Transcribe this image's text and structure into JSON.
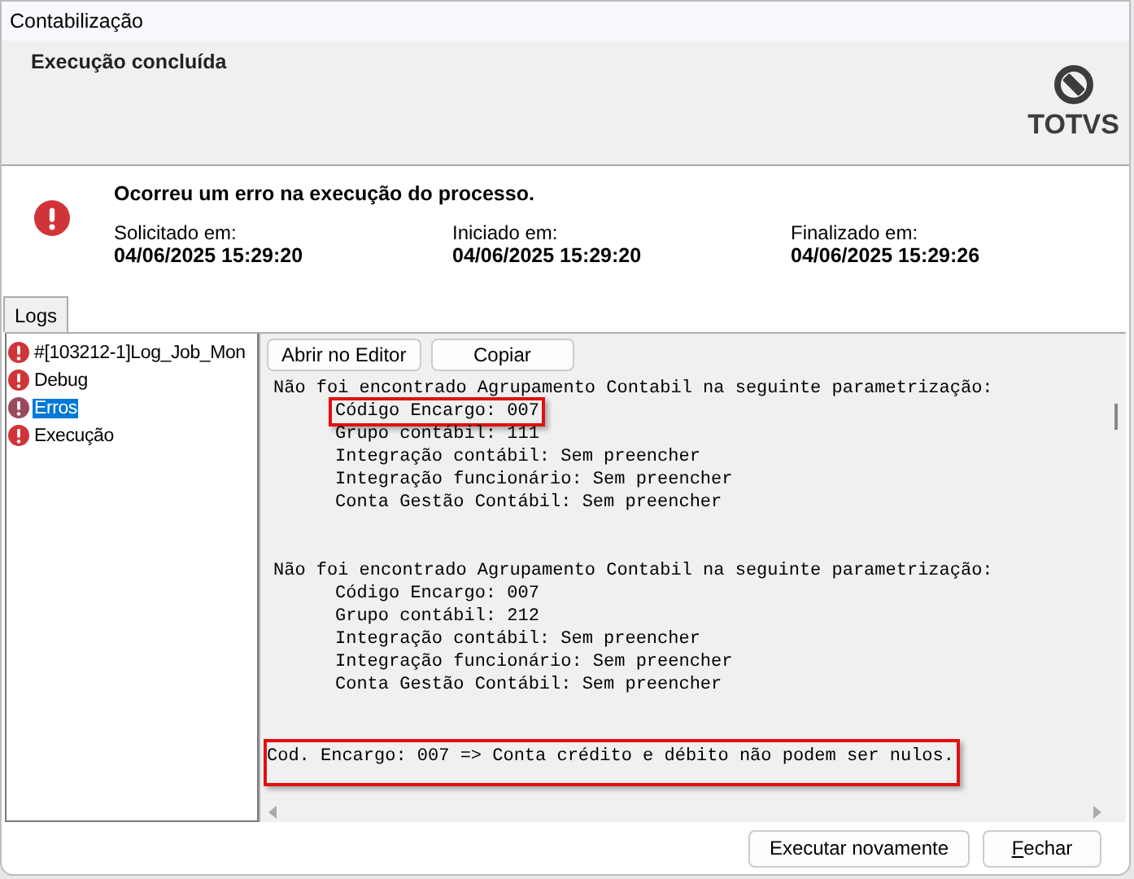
{
  "window": {
    "title": "Contabilização"
  },
  "header": {
    "title": "Execução concluída",
    "logo": "TOTVS"
  },
  "summary": {
    "message": "Ocorreu um erro na execução do processo.",
    "times": [
      {
        "label": "Solicitado em:",
        "value": "04/06/2025 15:29:20"
      },
      {
        "label": "Iniciado em:",
        "value": "04/06/2025 15:29:20"
      },
      {
        "label": "Finalizado em:",
        "value": "04/06/2025 15:29:26"
      }
    ]
  },
  "tabs": [
    {
      "label": "Logs",
      "selected": true
    }
  ],
  "log_tree": [
    {
      "label": "#[103212-1]Log_Job_Mon",
      "selected": false
    },
    {
      "label": "Debug",
      "selected": false
    },
    {
      "label": "Erros",
      "selected": true
    },
    {
      "label": "Execução",
      "selected": false
    }
  ],
  "log_buttons": [
    "Abrir no Editor",
    "Copiar"
  ],
  "log": [
    {
      "text": "Não foi encontrado Agrupamento Contabil na seguinte parametrização:",
      "highlighted": false,
      "children": [
        {
          "text": "Código Encargo: 007",
          "highlighted": true
        },
        {
          "text": "Grupo contábil: 111",
          "highlighted": false
        },
        {
          "text": "Integração contábil: Sem preencher",
          "highlighted": false
        },
        {
          "text": "Integração funcionário: Sem preencher",
          "highlighted": false
        },
        {
          "text": "Conta Gestão Contábil: Sem preencher",
          "highlighted": false
        }
      ]
    },
    {
      "text": "Não foi encontrado Agrupamento Contabil na seguinte parametrização:",
      "highlighted": false,
      "children": [
        {
          "text": "Código Encargo: 007",
          "highlighted": false
        },
        {
          "text": "Grupo contábil: 212",
          "highlighted": false
        },
        {
          "text": "Integração contábil: Sem preencher",
          "highlighted": false
        },
        {
          "text": "Integração funcionário: Sem preencher",
          "highlighted": false
        },
        {
          "text": "Conta Gestão Contábil: Sem preencher",
          "highlighted": false
        }
      ]
    },
    {
      "text": "Cod. Encargo: 007 => Conta crédito e débito não podem ser nulos.",
      "highlighted": true
    }
  ],
  "buttons": [
    "Executar novamente",
    "Fechar"
  ]
}
